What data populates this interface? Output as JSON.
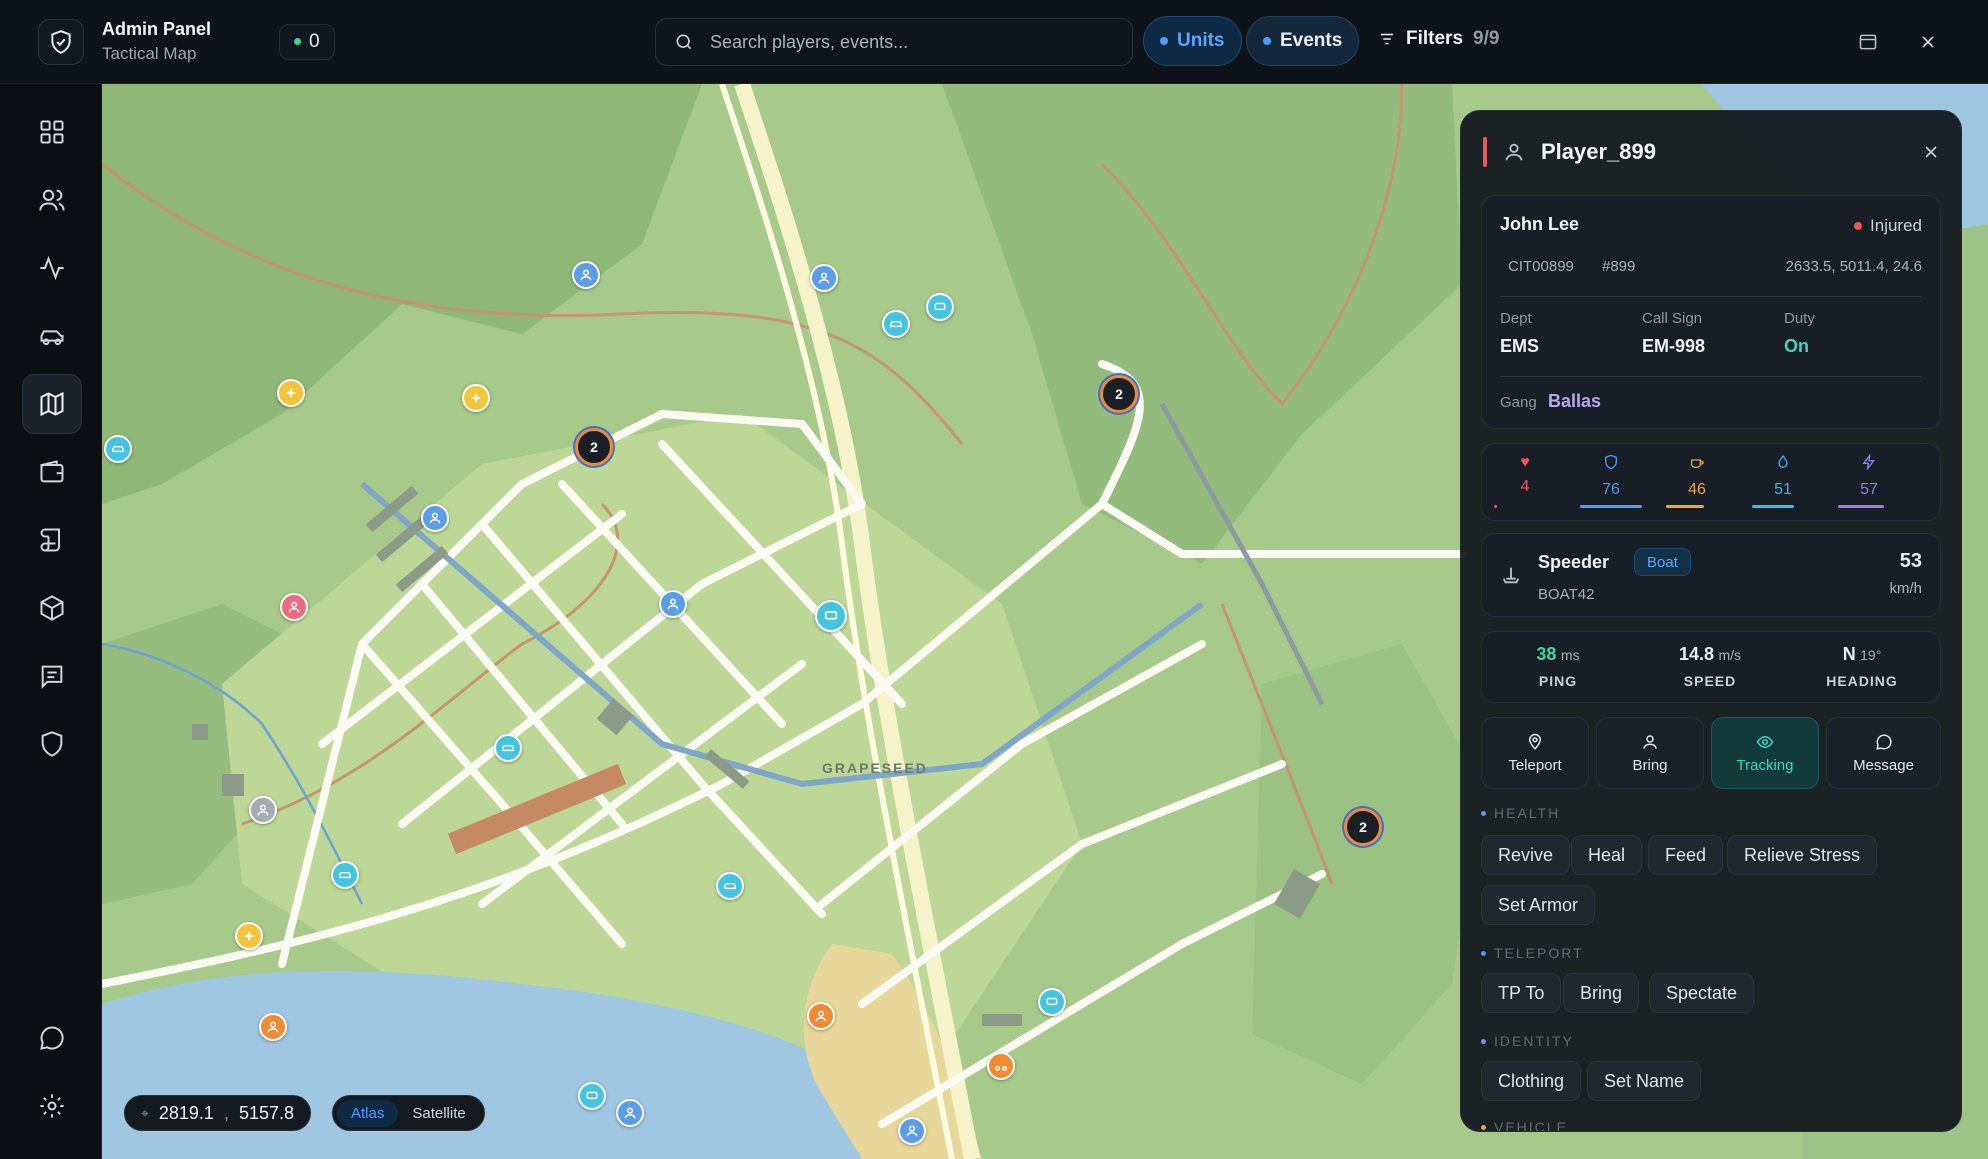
{
  "header": {
    "title": "Admin Panel",
    "subtitle": "Tactical Map",
    "online_count": "0",
    "search_placeholder": "Search players, events...",
    "units_label": "Units",
    "events_label": "Events",
    "filters_label": "Filters",
    "filters_count": "9/9"
  },
  "sidebar": {
    "items": [
      {
        "icon": "dashboard-icon",
        "active": false
      },
      {
        "icon": "users-icon",
        "active": false
      },
      {
        "icon": "activity-icon",
        "active": false
      },
      {
        "icon": "car-icon",
        "active": false
      },
      {
        "icon": "map-icon",
        "active": true
      },
      {
        "icon": "wallet-icon",
        "active": false
      },
      {
        "icon": "scroll-icon",
        "active": false
      },
      {
        "icon": "box-icon",
        "active": false
      },
      {
        "icon": "logs-icon",
        "active": false
      },
      {
        "icon": "shield-icon",
        "active": false
      }
    ],
    "bottom": [
      {
        "icon": "chat-icon"
      },
      {
        "icon": "settings-icon"
      }
    ]
  },
  "map": {
    "place_label": "GRAPESEED",
    "coord_x": "2819.1",
    "coord_sep": ",",
    "coord_y": "5157.8",
    "layers": {
      "atlas": "Atlas",
      "satellite": "Satellite",
      "active": "Atlas"
    },
    "clusters": [
      "2",
      "2",
      "2"
    ]
  },
  "panel": {
    "player_name": "Player_899",
    "character": {
      "name": "John Lee",
      "status": "Injured",
      "citizen_id": "CIT00899",
      "player_id": "#899",
      "position": "2633.5, 5011.4, 24.6",
      "dept_label": "Dept",
      "dept": "EMS",
      "callsign_label": "Call Sign",
      "callsign": "EM-998",
      "duty_label": "Duty",
      "duty": "On",
      "gang_label": "Gang",
      "gang": "Ballas"
    },
    "stats": [
      {
        "icon": "heart-icon",
        "value": "4",
        "color": "#f2545b"
      },
      {
        "icon": "armor-icon",
        "value": "76",
        "color": "#4c9cff"
      },
      {
        "icon": "food-icon",
        "value": "46",
        "color": "#f0a43a"
      },
      {
        "icon": "water-icon",
        "value": "51",
        "color": "#3ab8f0"
      },
      {
        "icon": "stress-icon",
        "value": "57",
        "color": "#9b7cf0"
      }
    ],
    "vehicle": {
      "name": "Speeder",
      "type": "Boat",
      "plate": "BOAT42",
      "speed": "53",
      "speed_unit": "km/h"
    },
    "telemetry": {
      "ping_value": "38",
      "ping_unit": "ms",
      "ping_label": "PING",
      "speed_value": "14.8",
      "speed_unit": "m/s",
      "speed_label": "SPEED",
      "heading_value": "N",
      "heading_deg": "19°",
      "heading_label": "HEADING"
    },
    "actions": [
      {
        "label": "Teleport",
        "icon": "pin-icon"
      },
      {
        "label": "Bring",
        "icon": "person-icon"
      },
      {
        "label": "Tracking",
        "icon": "eye-icon"
      },
      {
        "label": "Message",
        "icon": "message-icon"
      }
    ],
    "sections": {
      "health": {
        "title": "HEALTH",
        "items": [
          "Revive",
          "Heal",
          "Feed",
          "Relieve Stress",
          "Set Armor"
        ]
      },
      "teleport": {
        "title": "TELEPORT",
        "items": [
          "TP To",
          "Bring",
          "Spectate"
        ]
      },
      "identity": {
        "title": "IDENTITY",
        "items": [
          "Clothing",
          "Set Name"
        ]
      },
      "vehicle": {
        "title": "VEHICLE"
      }
    }
  }
}
